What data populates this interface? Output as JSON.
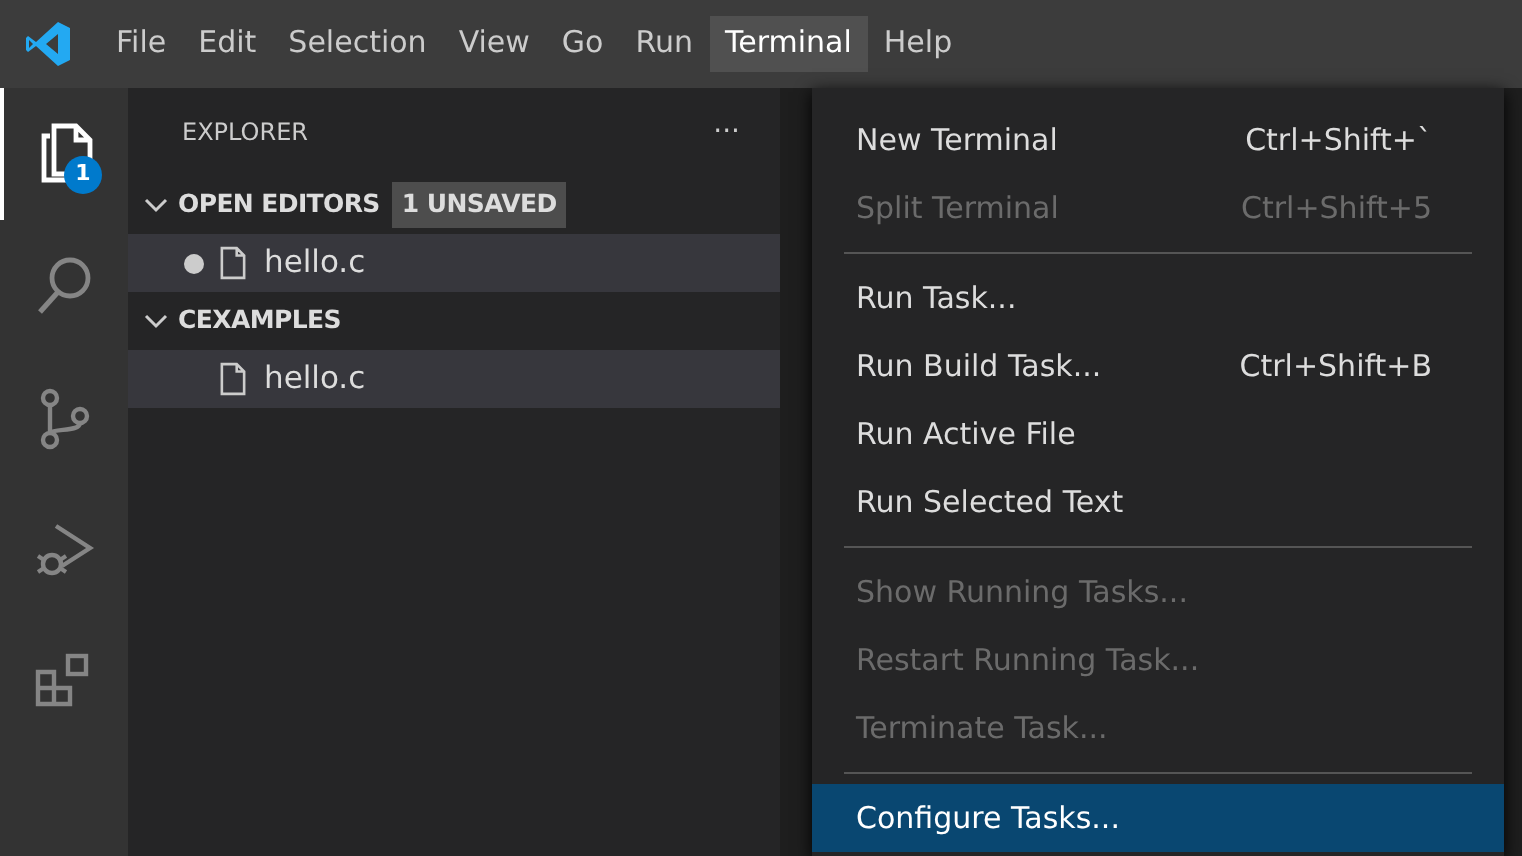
{
  "menubar": [
    {
      "label": "File",
      "selected": false
    },
    {
      "label": "Edit",
      "selected": false
    },
    {
      "label": "Selection",
      "selected": false
    },
    {
      "label": "View",
      "selected": false
    },
    {
      "label": "Go",
      "selected": false
    },
    {
      "label": "Run",
      "selected": false
    },
    {
      "label": "Terminal",
      "selected": true
    },
    {
      "label": "Help",
      "selected": false
    }
  ],
  "activity_bar": [
    {
      "kind": "explorer",
      "selected": true,
      "badge": "1"
    },
    {
      "kind": "search",
      "selected": false
    },
    {
      "kind": "source-control",
      "selected": false
    },
    {
      "kind": "run-debug",
      "selected": false
    },
    {
      "kind": "extensions",
      "selected": false
    }
  ],
  "sidebar": {
    "title": "EXPLORER",
    "more": "···",
    "sections": [
      {
        "title": "OPEN EDITORS",
        "expanded": true,
        "badge": "1 UNSAVED",
        "items": [
          {
            "label": "hello.c",
            "dirty": true,
            "selected": true
          }
        ]
      },
      {
        "title": "CEXAMPLES",
        "expanded": true,
        "items": [
          {
            "label": "hello.c",
            "dirty": false,
            "selected": true
          }
        ]
      }
    ]
  },
  "terminal_menu": {
    "groups": [
      [
        {
          "label": "New Terminal",
          "shortcut": "Ctrl+Shift+`",
          "disabled": false,
          "selected": false
        },
        {
          "label": "Split Terminal",
          "shortcut": "Ctrl+Shift+5",
          "disabled": true,
          "selected": false
        }
      ],
      [
        {
          "label": "Run Task...",
          "disabled": false,
          "selected": false
        },
        {
          "label": "Run Build Task...",
          "shortcut": "Ctrl+Shift+B",
          "disabled": false,
          "selected": false
        },
        {
          "label": "Run Active File",
          "disabled": false,
          "selected": false
        },
        {
          "label": "Run Selected Text",
          "disabled": false,
          "selected": false
        }
      ],
      [
        {
          "label": "Show Running Tasks...",
          "disabled": true,
          "selected": false
        },
        {
          "label": "Restart Running Task...",
          "disabled": true,
          "selected": false
        },
        {
          "label": "Terminate Task...",
          "disabled": true,
          "selected": false
        }
      ],
      [
        {
          "label": "Configure Tasks...",
          "disabled": false,
          "selected": true
        }
      ]
    ]
  }
}
